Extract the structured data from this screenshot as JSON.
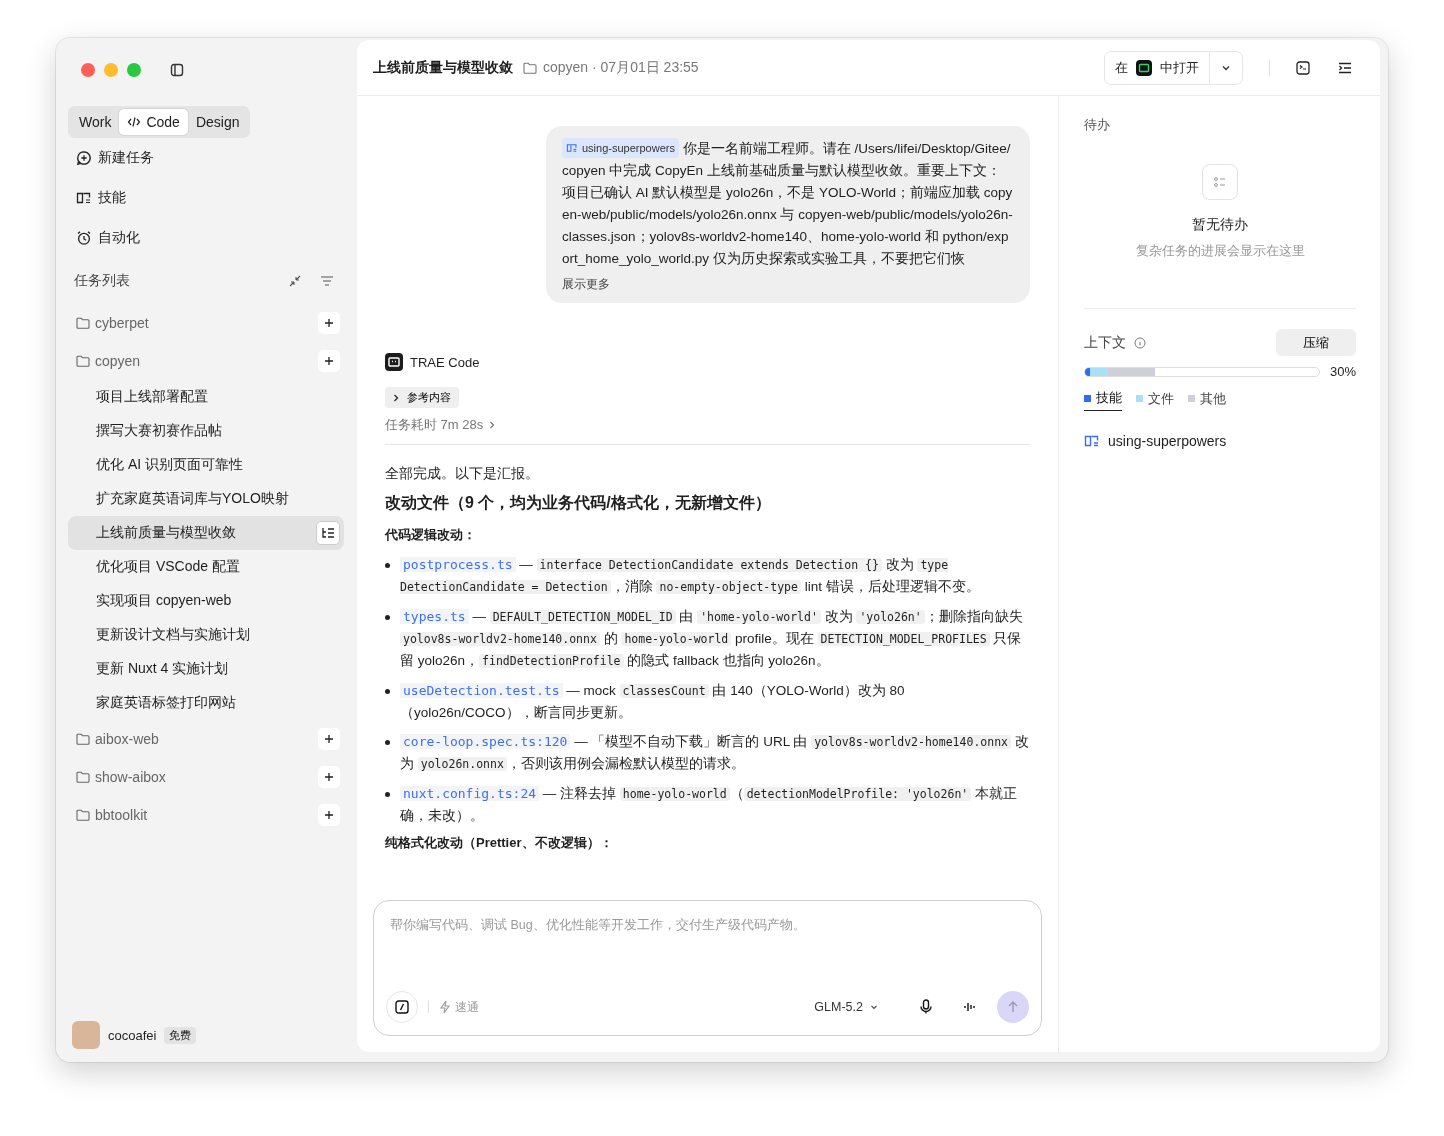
{
  "sidebar": {
    "modes": [
      {
        "label": "Work",
        "selected": false
      },
      {
        "label": "Code",
        "selected": true
      },
      {
        "label": "Design",
        "selected": false
      }
    ],
    "nav": [
      {
        "kind": "new",
        "label": "新建任务"
      },
      {
        "kind": "skills",
        "label": "技能"
      },
      {
        "kind": "automation",
        "label": "自动化"
      }
    ],
    "task_list_title": "任务列表",
    "projects": [
      {
        "name": "cyberpet"
      },
      {
        "name": "copyen",
        "tasks": [
          {
            "label": "项目上线部署配置",
            "selected": false
          },
          {
            "label": "撰写大赛初赛作品帖",
            "selected": false
          },
          {
            "label": "优化 AI 识别页面可靠性",
            "selected": false
          },
          {
            "label": "扩充家庭英语词库与YOLO映射",
            "selected": false
          },
          {
            "label": "上线前质量与模型收敛",
            "selected": true
          },
          {
            "label": "优化项目 VSCode 配置",
            "selected": false
          },
          {
            "label": "实现项目 copyen-web",
            "selected": false
          },
          {
            "label": "更新设计文档与实施计划",
            "selected": false
          },
          {
            "label": "更新 Nuxt 4 实施计划",
            "selected": false
          },
          {
            "label": "家庭英语标签打印网站",
            "selected": false
          }
        ]
      },
      {
        "name": "aibox-web"
      },
      {
        "name": "show-aibox"
      },
      {
        "name": "bbtoolkit"
      }
    ],
    "user": {
      "name": "cocoafei",
      "badge": "免费"
    }
  },
  "header": {
    "title": "上线前质量与模型收敛",
    "meta": "copyen · 07月01日 23:55",
    "open_in_prefix": "在",
    "open_in_suffix": "中打开"
  },
  "chat": {
    "prompt": {
      "skill": "using-superpowers",
      "text": "你是一名前端工程师。请在 /Users/lifei/Desktop/Gitee/copyen 中完成 CopyEn 上线前基础质量与默认模型收敛。重要上下文：项目已确认 AI 默认模型是 yolo26n，不是 YOLO-World；前端应加载 copyen-web/public/models/yolo26n.onnx 与 copyen-web/public/models/yolo26n-classes.json；yolov8s-worldv2-home140、home-yolo-world 和 python/export_home_yolo_world.py 仅为历史探索或实验工具，不要把它们恢",
      "show_more": "展示更多"
    },
    "agent": "TRAE Code",
    "references": "参考内容",
    "duration": "任务耗时 7m 28s",
    "report": {
      "intro": "全部完成。以下是汇报。",
      "heading": "改动文件（9 个，均为业务代码/格式化，无新增文件）",
      "subheading": "代码逻辑改动：",
      "items": [
        [
          {
            "kind": "link",
            "text": "postprocess.ts"
          },
          {
            "kind": "text",
            "text": " — "
          },
          {
            "kind": "code",
            "text": "interface DetectionCandidate extends Detection {}"
          },
          {
            "kind": "text",
            "text": " 改为 "
          },
          {
            "kind": "code",
            "text": "type DetectionCandidate = Detection"
          },
          {
            "kind": "text",
            "text": "，消除 "
          },
          {
            "kind": "code",
            "text": "no-empty-object-type"
          },
          {
            "kind": "text",
            "text": " lint 错误，后处理逻辑不变。"
          }
        ],
        [
          {
            "kind": "link",
            "text": "types.ts"
          },
          {
            "kind": "text",
            "text": " — "
          },
          {
            "kind": "code",
            "text": "DEFAULT_DETECTION_MODEL_ID"
          },
          {
            "kind": "text",
            "text": " 由 "
          },
          {
            "kind": "code",
            "text": "'home-yolo-world'"
          },
          {
            "kind": "text",
            "text": " 改为 "
          },
          {
            "kind": "code",
            "text": "'yolo26n'"
          },
          {
            "kind": "text",
            "text": "；删除指向缺失 "
          },
          {
            "kind": "code",
            "text": "yolov8s-worldv2-home140.onnx"
          },
          {
            "kind": "text",
            "text": " 的 "
          },
          {
            "kind": "code",
            "text": "home-yolo-world"
          },
          {
            "kind": "text",
            "text": " profile。现在 "
          },
          {
            "kind": "code",
            "text": "DETECTION_MODEL_PROFILES"
          },
          {
            "kind": "text",
            "text": " 只保留 yolo26n，"
          },
          {
            "kind": "code",
            "text": "findDetectionProfile"
          },
          {
            "kind": "text",
            "text": " 的隐式 fallback 也指向 yolo26n。"
          }
        ],
        [
          {
            "kind": "link",
            "text": "useDetection.test.ts"
          },
          {
            "kind": "text",
            "text": " — mock "
          },
          {
            "kind": "code",
            "text": "classesCount"
          },
          {
            "kind": "text",
            "text": " 由 140（YOLO-World）改为 80（yolo26n/COCO），断言同步更新。"
          }
        ],
        [
          {
            "kind": "link",
            "text": "core-loop.spec.ts:120"
          },
          {
            "kind": "text",
            "text": " — 「模型不自动下载」断言的 URL 由 "
          },
          {
            "kind": "code",
            "text": "yolov8s-worldv2-home140.onnx"
          },
          {
            "kind": "text",
            "text": " 改为 "
          },
          {
            "kind": "code",
            "text": "yolo26n.onnx"
          },
          {
            "kind": "text",
            "text": "，否则该用例会漏检默认模型的请求。"
          }
        ],
        [
          {
            "kind": "link",
            "text": "nuxt.config.ts:24"
          },
          {
            "kind": "text",
            "text": " — 注释去掉 "
          },
          {
            "kind": "code",
            "text": "home-yolo-world"
          },
          {
            "kind": "text",
            "text": "（"
          },
          {
            "kind": "code",
            "text": "detectionModelProfile: 'yolo26n'"
          },
          {
            "kind": "text",
            "text": " 本就正确，未改）。"
          }
        ]
      ],
      "next_subheading": "纯格式化改动（Prettier、不改逻辑）："
    },
    "input": {
      "placeholder": "帮你编写代码、调试 Bug、优化性能等开发工作，交付生产级代码产物。",
      "mode": "速通",
      "model": "GLM-5.2"
    }
  },
  "todo": {
    "title": "待办",
    "empty_title": "暂无待办",
    "empty_text": "复杂任务的进展会显示在这里"
  },
  "context": {
    "title": "上下文",
    "compress": "压缩",
    "reading": "30%",
    "usage": [
      {
        "color": "#2f6bf5",
        "level": 0.02
      },
      {
        "color": "#a8e0fa",
        "level": 0.08
      },
      {
        "color": "#cdd0d8",
        "level": 0.2
      }
    ],
    "legend": [
      {
        "label": "技能",
        "color": "#2f6bf5",
        "selected": true
      },
      {
        "label": "文件",
        "color": "#a8e0fa",
        "selected": false
      },
      {
        "label": "其他",
        "color": "#cdd0d8",
        "selected": false
      }
    ],
    "skills": [
      "using-superpowers"
    ]
  }
}
